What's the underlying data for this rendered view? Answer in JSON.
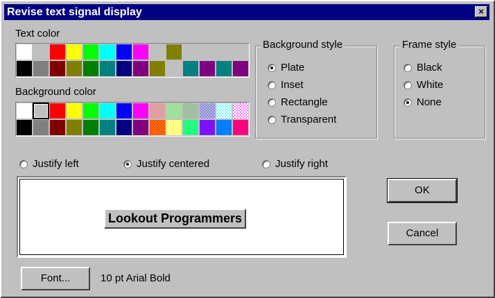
{
  "dialog": {
    "title": "Revise text signal display",
    "close_glyph": "×"
  },
  "text_color": {
    "label": "Text color",
    "swatches": [
      "#ffffff",
      "#c0c0c0",
      "#ff0000",
      "#ffff00",
      "#00ff00",
      "#00ffff",
      "#0000ff",
      "#ff00ff",
      "#c0c0c0",
      "#808000",
      "#c0c0c0",
      "#c0c0c0",
      "#c0c0c0",
      "#c0c0c0",
      "#000000",
      "#808080",
      "#800000",
      "#808000",
      "#008000",
      "#008080",
      "#000080",
      "#800080",
      "#808000",
      "#c0c0c0",
      "#008080",
      "#800080",
      "#008080",
      "#800080"
    ]
  },
  "background_color": {
    "label": "Background color",
    "selected_index": 1,
    "swatches": [
      {
        "c": "#ffffff"
      },
      {
        "c": "#c0c0c0"
      },
      {
        "c": "#ff0000"
      },
      {
        "c": "#ffff00"
      },
      {
        "c": "#00ff00"
      },
      {
        "c": "#00ffff"
      },
      {
        "c": "#0000ff"
      },
      {
        "c": "#ff00ff"
      },
      {
        "c1": "#ff8080",
        "c2": "#c0c0c0"
      },
      {
        "c1": "#80ff80",
        "c2": "#c0c0c0"
      },
      {
        "c1": "#80c080",
        "c2": "#c0c0c0"
      },
      {
        "c1": "#8080ff",
        "c2": "#c0c0c0"
      },
      {
        "c1": "#80ffff",
        "c2": "#ffffff"
      },
      {
        "c1": "#ff80ff",
        "c2": "#ffffff"
      },
      {
        "c": "#000000"
      },
      {
        "c": "#808080"
      },
      {
        "c": "#800000"
      },
      {
        "c": "#808000"
      },
      {
        "c": "#008000"
      },
      {
        "c": "#008080"
      },
      {
        "c": "#000080"
      },
      {
        "c": "#800080"
      },
      {
        "c1": "#ff8000",
        "c2": "#ff4000"
      },
      {
        "c1": "#ffff80",
        "c2": "#ffff80"
      },
      {
        "c1": "#00ff80",
        "c2": "#40ff80"
      },
      {
        "c1": "#8000ff",
        "c2": "#8020ff"
      },
      {
        "c1": "#0080ff",
        "c2": "#0080ff"
      },
      {
        "c1": "#ff0080",
        "c2": "#ff0080"
      }
    ]
  },
  "background_style": {
    "title": "Background style",
    "options": [
      "Plate",
      "Inset",
      "Rectangle",
      "Transparent"
    ],
    "selected": 0
  },
  "frame_style": {
    "title": "Frame style",
    "options": [
      "Black",
      "White",
      "None"
    ],
    "selected": 2
  },
  "justify": {
    "options": [
      "Justify left",
      "Justify centered",
      "Justify right"
    ],
    "selected": 1
  },
  "preview": {
    "text": "Lookout Programmers"
  },
  "buttons": {
    "ok": "OK",
    "cancel": "Cancel",
    "font": "Font..."
  },
  "font_desc": "10 pt Arial Bold"
}
